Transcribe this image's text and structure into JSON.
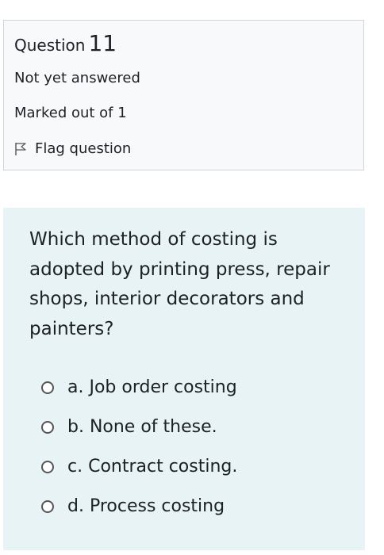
{
  "info": {
    "question_label": "Question",
    "question_number": "11",
    "state": "Not yet answered",
    "grade": "Marked out of 1",
    "flag_label": "Flag question",
    "flag_icon": "flag-outline-icon"
  },
  "question": {
    "text": "Which method of costing is adopted by printing press, repair shops, interior decorators and painters?",
    "answers": [
      {
        "label": "a. Job order costing",
        "selected": false
      },
      {
        "label": "b. None of these.",
        "selected": false
      },
      {
        "label": "c. Contract costing.",
        "selected": false
      },
      {
        "label": "d. Process costing",
        "selected": false
      }
    ]
  },
  "colors": {
    "info_background": "#f8f9fa",
    "info_border": "#cfd4d9",
    "question_background": "#e7f3f5",
    "text": "#1d2125"
  }
}
